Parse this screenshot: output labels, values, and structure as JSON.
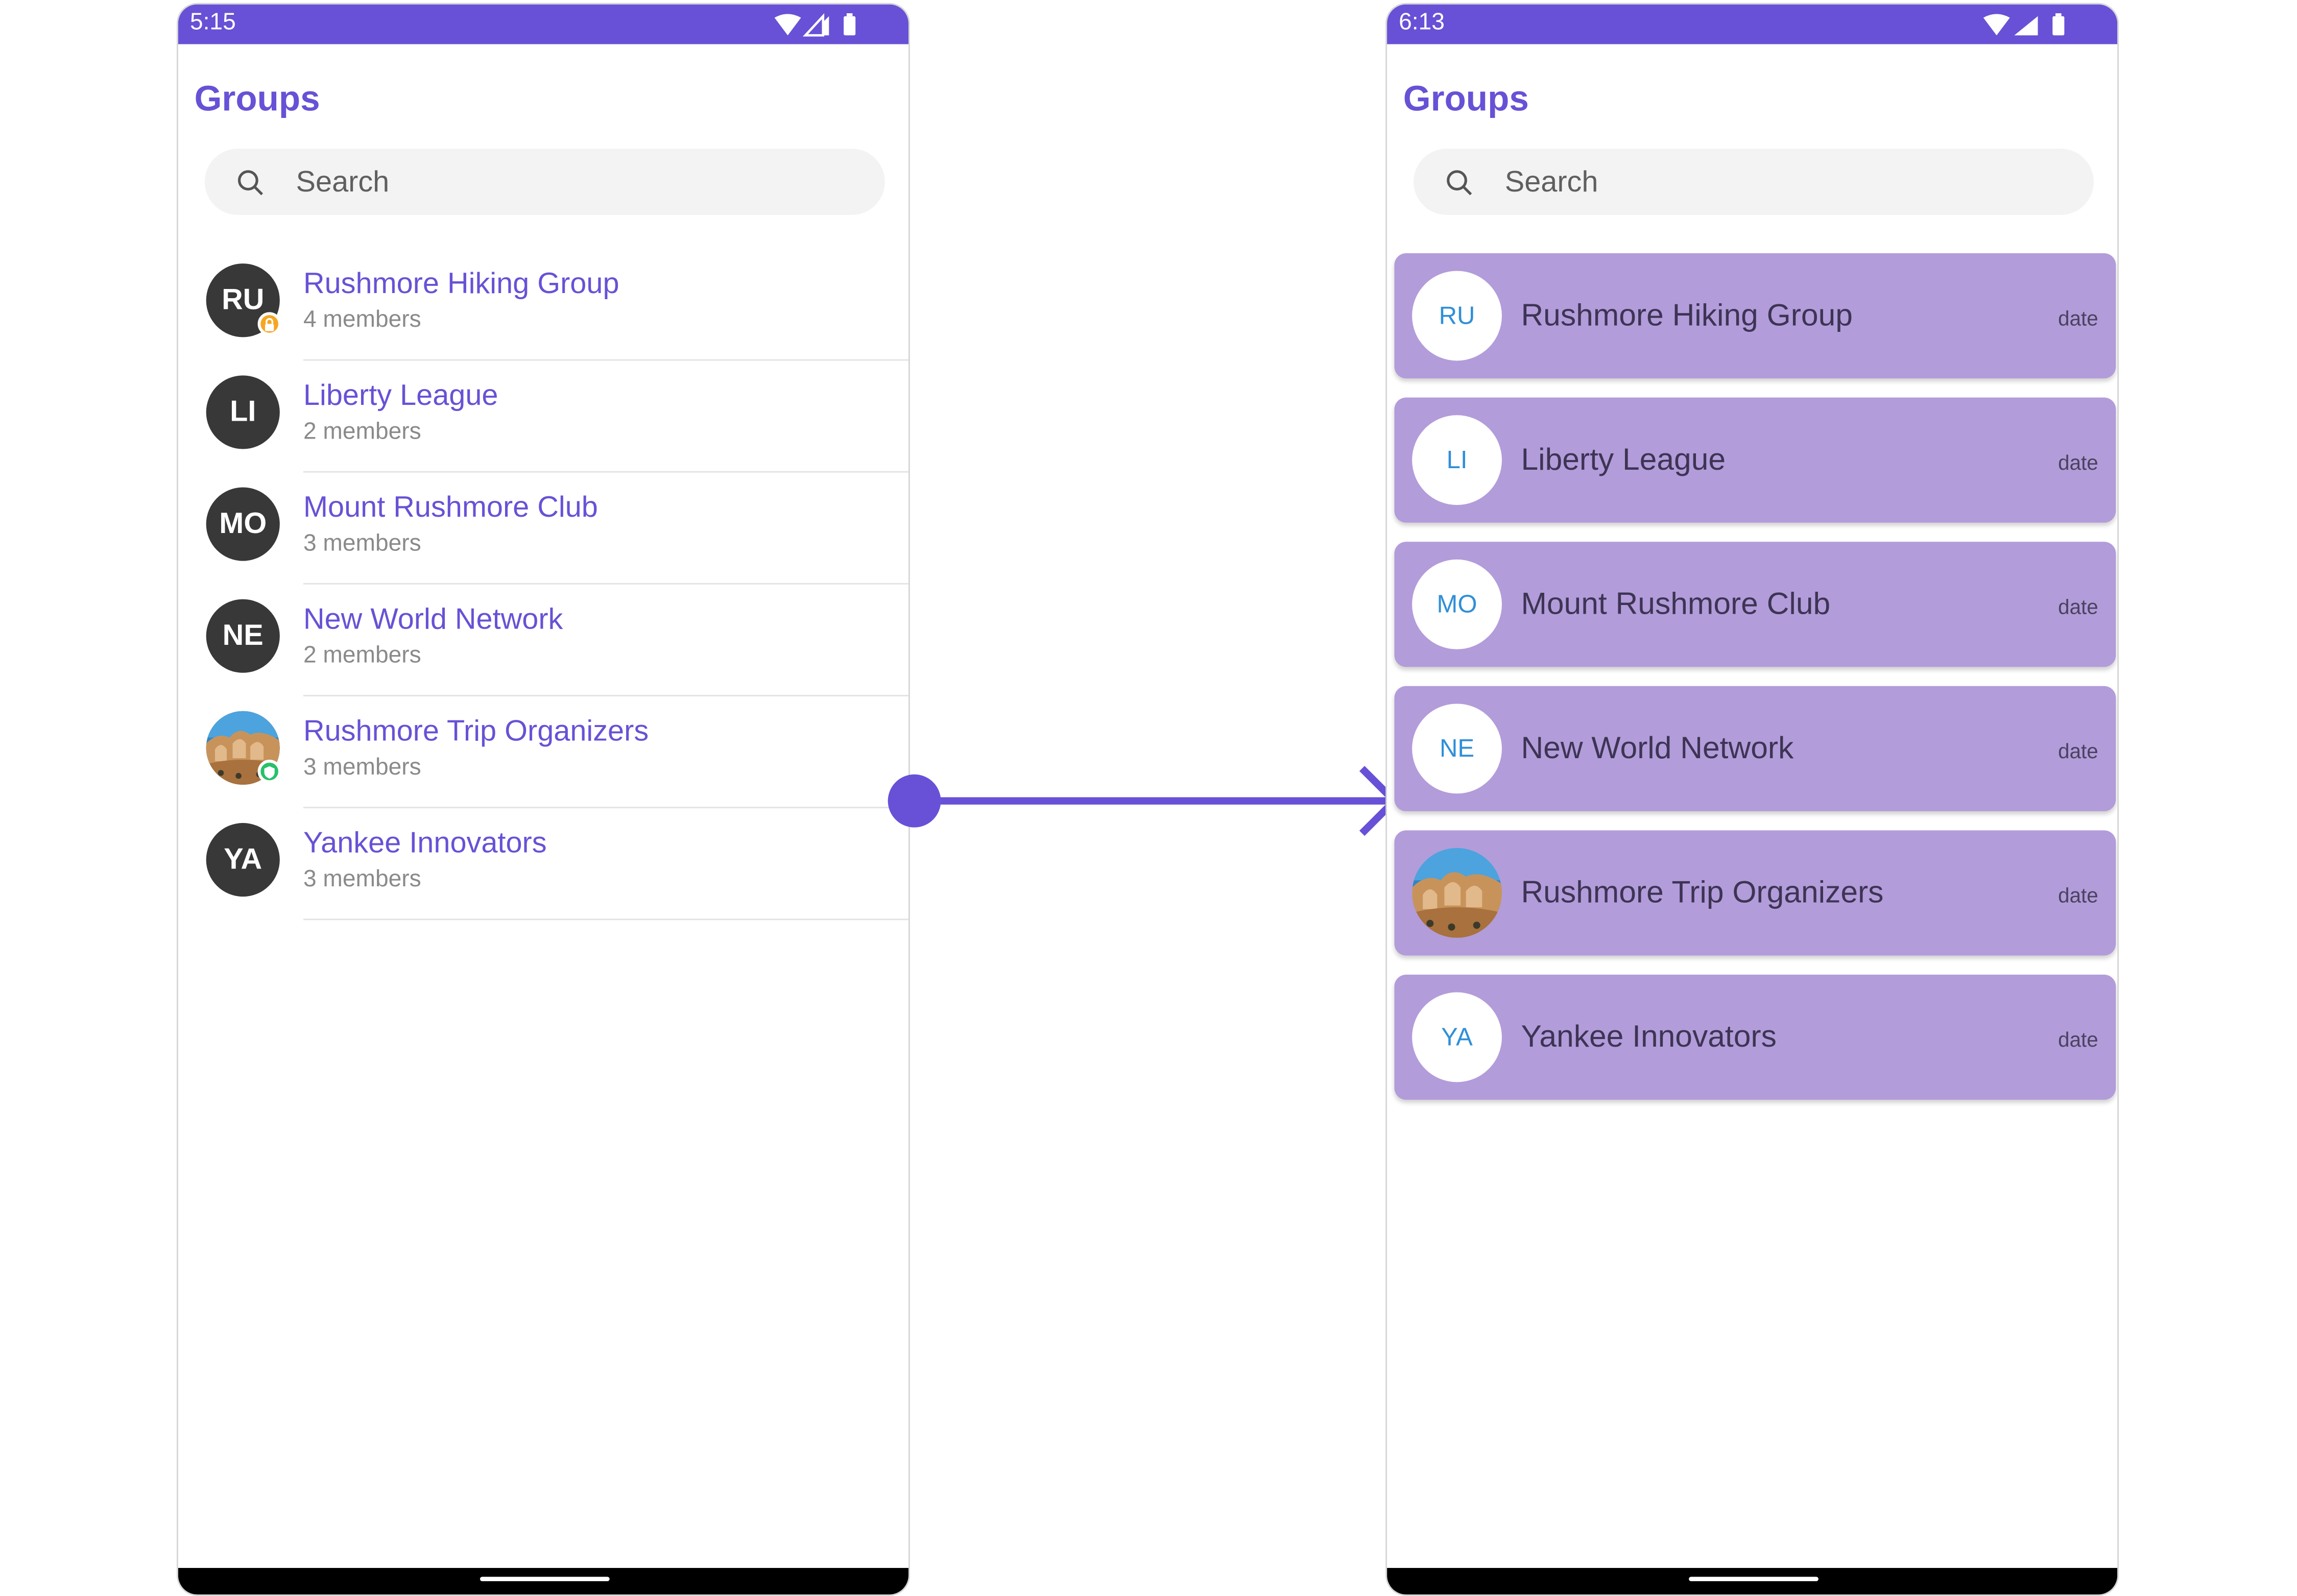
{
  "theme": {
    "accent": "#6851d6",
    "card_bg": "#b29cda",
    "avatar_dark": "#383838",
    "initials_blue": "#2f8fd8"
  },
  "left": {
    "status": {
      "time": "5:15"
    },
    "title": "Groups",
    "search": {
      "placeholder": "Search"
    },
    "groups": [
      {
        "initials": "RU",
        "name": "Rushmore Hiking Group",
        "members": "4 members",
        "badge": "lock-icon"
      },
      {
        "initials": "LI",
        "name": "Liberty League",
        "members": "2 members"
      },
      {
        "initials": "MO",
        "name": "Mount Rushmore Club",
        "members": "3 members"
      },
      {
        "initials": "NE",
        "name": "New World Network",
        "members": "2 members"
      },
      {
        "initials": "",
        "name": "Rushmore Trip Organizers",
        "members": "3 members",
        "photo": true,
        "badge": "shield-icon"
      },
      {
        "initials": "YA",
        "name": "Yankee Innovators",
        "members": "3 members"
      }
    ]
  },
  "right": {
    "status": {
      "time": "6:13"
    },
    "title": "Groups",
    "search": {
      "placeholder": "Search"
    },
    "groups": [
      {
        "initials": "RU",
        "name": "Rushmore Hiking Group",
        "date": "date"
      },
      {
        "initials": "LI",
        "name": "Liberty League",
        "date": "date"
      },
      {
        "initials": "MO",
        "name": "Mount Rushmore Club",
        "date": "date"
      },
      {
        "initials": "NE",
        "name": "New World Network",
        "date": "date"
      },
      {
        "initials": "",
        "name": "Rushmore Trip Organizers",
        "date": "date",
        "photo": true
      },
      {
        "initials": "YA",
        "name": "Yankee Innovators",
        "date": "date"
      }
    ]
  }
}
